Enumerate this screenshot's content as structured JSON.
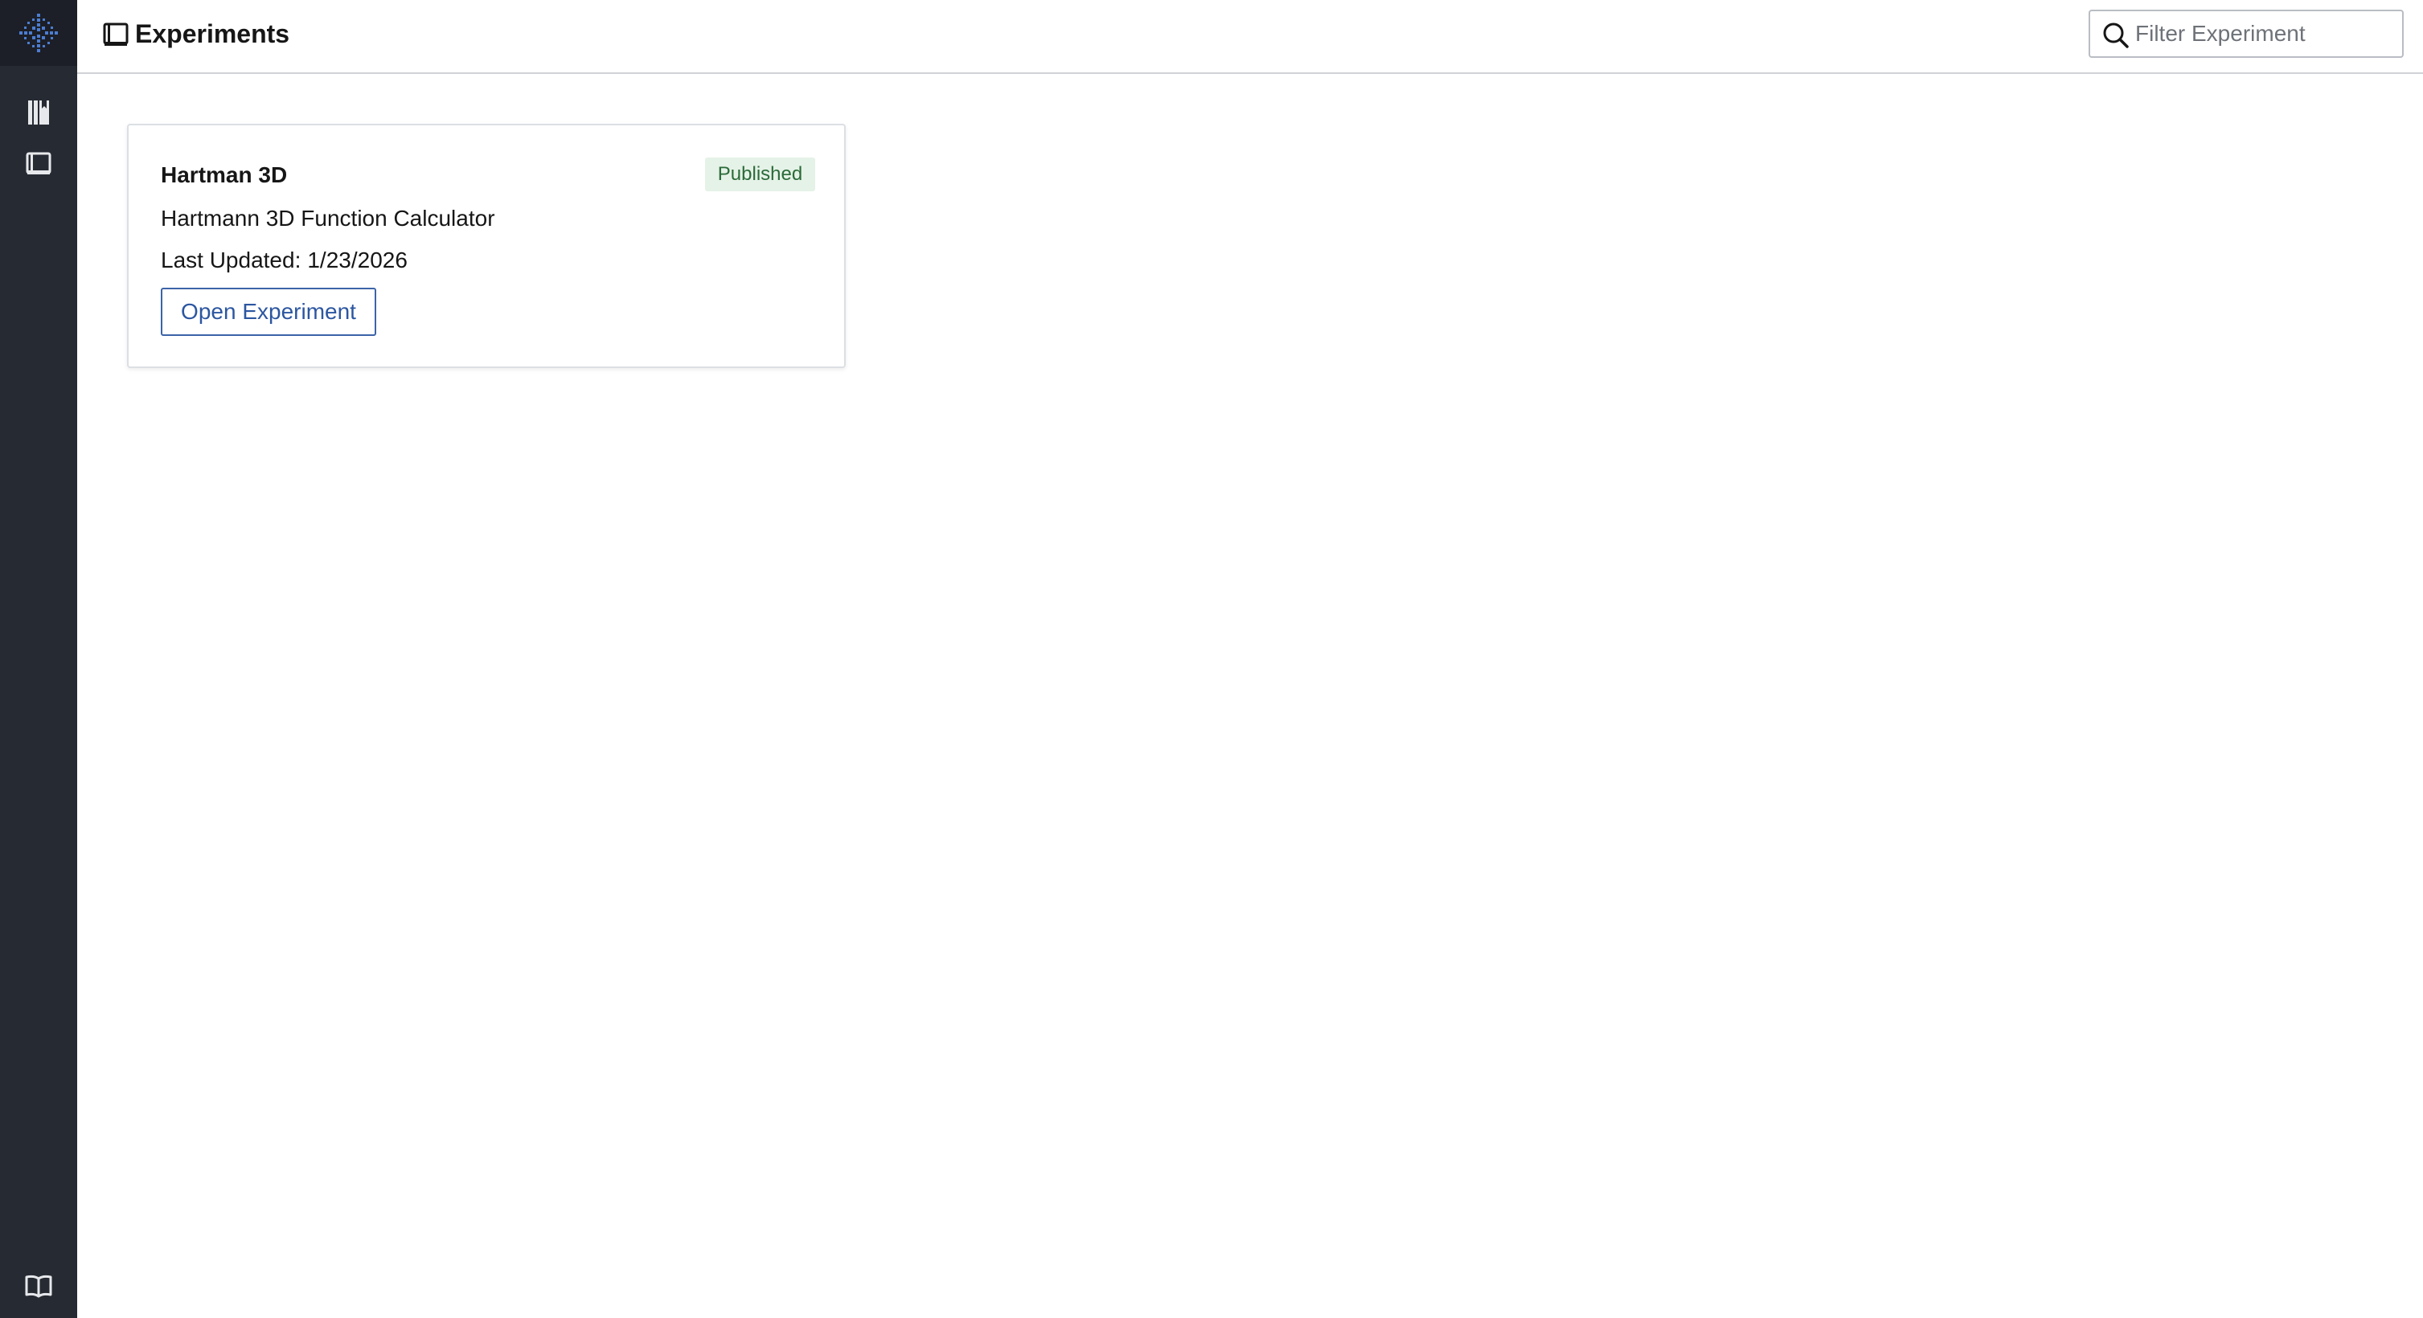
{
  "sidebar": {
    "logo_icon": "sparkle-grid-logo-icon",
    "items": [
      {
        "icon": "library-icon"
      },
      {
        "icon": "notebook-icon"
      }
    ],
    "footer_icon": "open-book-icon",
    "background": "#262a33",
    "logo_background": "#1c1f27",
    "accent": "#4c7dd1"
  },
  "header": {
    "title_icon": "notebook-icon",
    "title": "Experiments",
    "search": {
      "icon": "search-icon",
      "placeholder": "Filter Experiment",
      "value": ""
    }
  },
  "experiments": [
    {
      "title": "Hartman 3D",
      "status": "Published",
      "description": "Hartmann 3D Function Calculator",
      "last_updated_label": "Last Updated:",
      "last_updated_value": "1/23/2026",
      "action_label": "Open Experiment"
    }
  ],
  "colors": {
    "status_published_bg": "#e5f2e7",
    "status_published_text": "#2a6b39",
    "button_border": "#3c63a8",
    "button_text": "#2c56a0"
  }
}
